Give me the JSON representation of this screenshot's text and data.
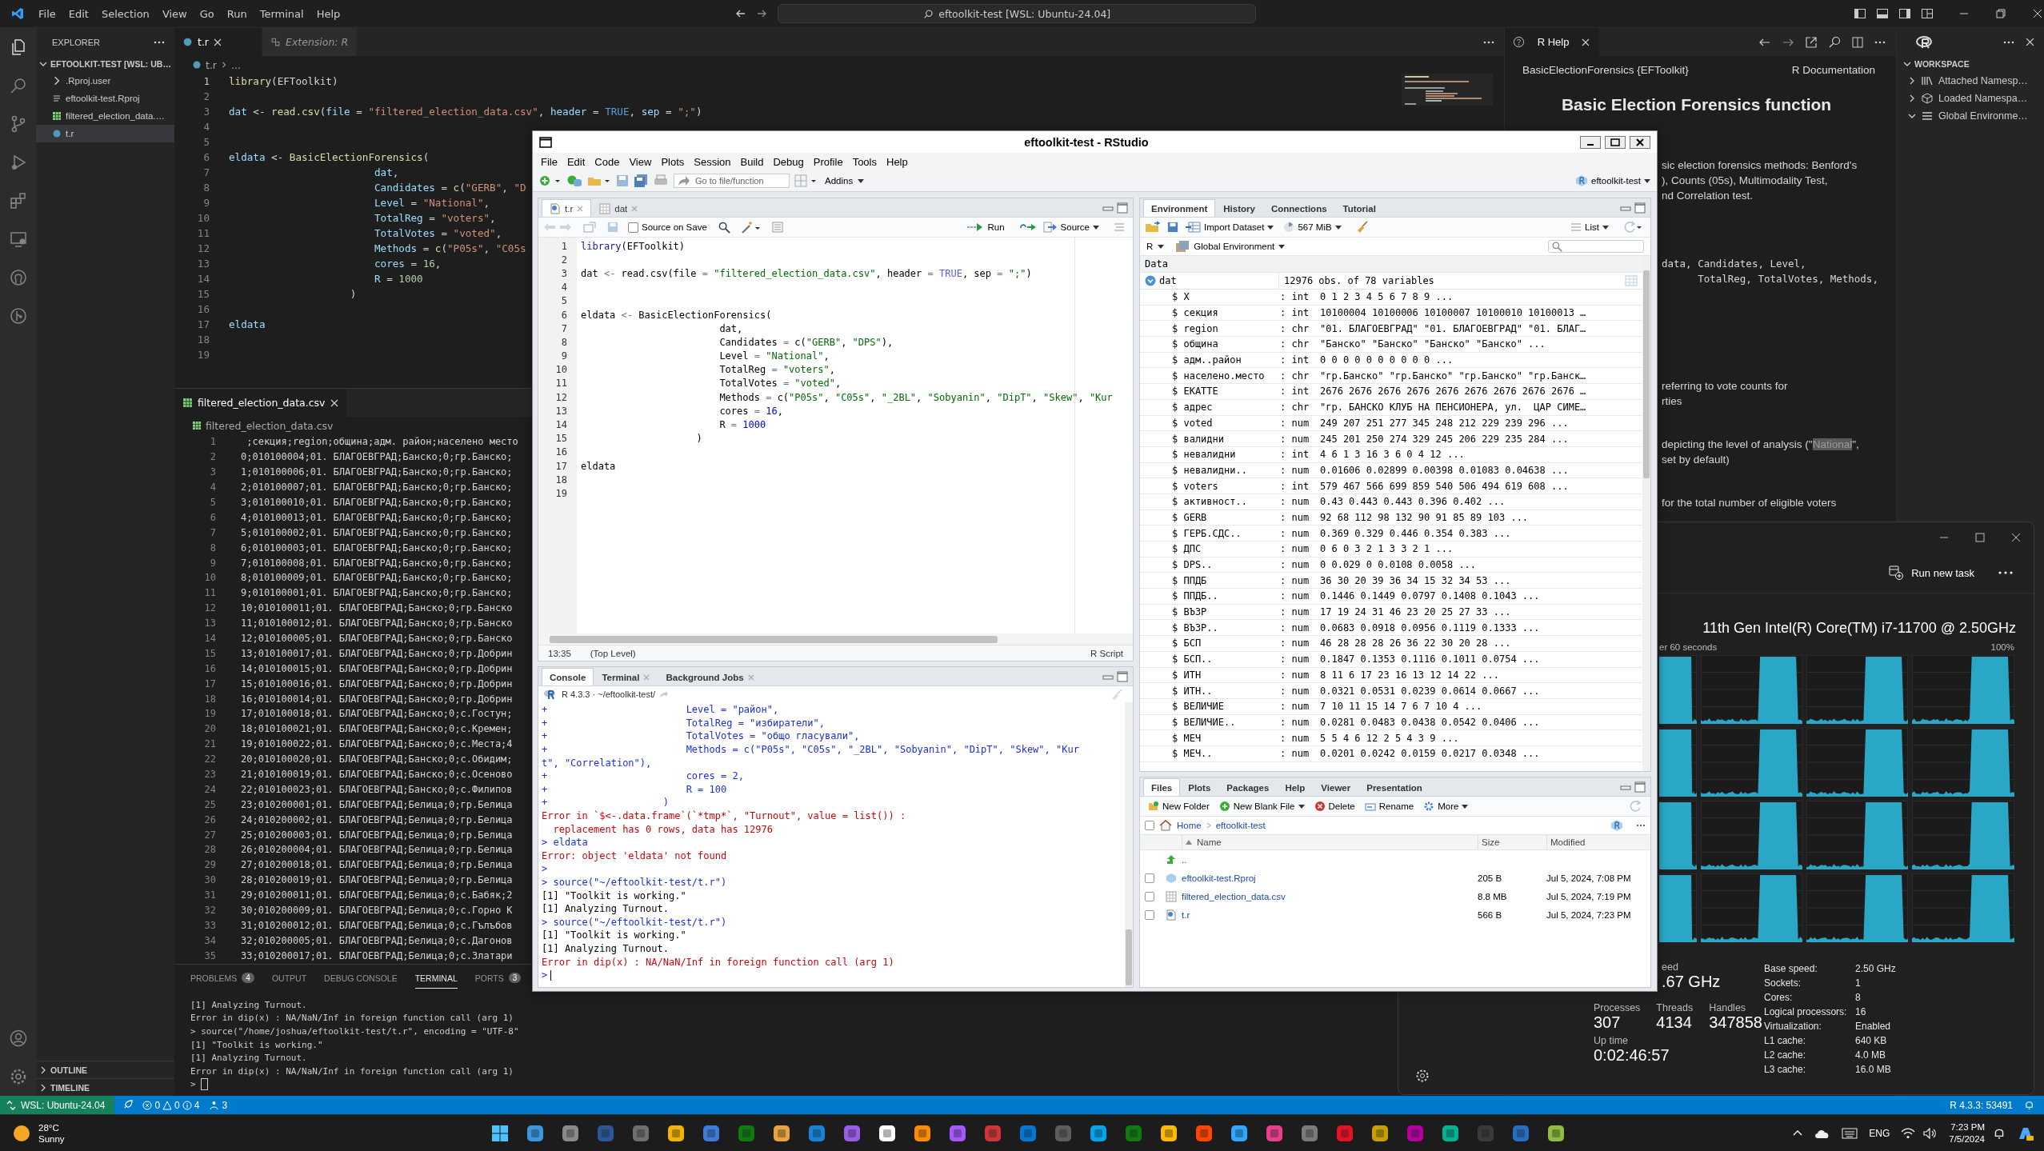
{
  "vscode": {
    "menu": [
      "File",
      "Edit",
      "Selection",
      "View",
      "Go",
      "Run",
      "Terminal",
      "Help"
    ],
    "search": "eftoolkit-test [WSL: Ubuntu-24.04]",
    "explorer": {
      "title": "EXPLORER",
      "root": "EFTOOLKIT-TEST [WSL: UB…",
      "expanded": true,
      "items": [
        {
          "label": ".Rproj.user",
          "kind": "folder",
          "selected": false
        },
        {
          "label": "eftoolkit-test.Rproj",
          "kind": "rproj",
          "selected": false
        },
        {
          "label": "filtered_election_data.…",
          "kind": "csv",
          "selected": false
        },
        {
          "label": "t.r",
          "kind": "r",
          "selected": true
        }
      ],
      "sections": [
        "OUTLINE",
        "TIMELINE"
      ]
    },
    "tabs": [
      {
        "label": "t.r",
        "kind": "r",
        "selected": true
      },
      {
        "label": "Extension: R",
        "kind": "ext",
        "selected": false
      }
    ],
    "breadcrumb": [
      "t.r",
      "..."
    ],
    "code": [
      {
        "n": "1",
        "s": [
          {
            "text": "library",
            "kind": "fn"
          },
          {
            "text": "(EFToolkit)",
            "kind": "p"
          }
        ]
      },
      {
        "n": "2"
      },
      {
        "n": "3",
        "s": [
          {
            "text": "dat",
            "kind": "var"
          },
          {
            "text": " <- ",
            "kind": "p"
          },
          {
            "text": "read.csv",
            "kind": "fn"
          },
          {
            "text": "(",
            "kind": "p"
          },
          {
            "text": "file",
            "kind": "var"
          },
          {
            "text": " = ",
            "kind": "p"
          },
          {
            "text": "\"filtered_election_data.csv\"",
            "kind": "str"
          },
          {
            "text": ", ",
            "kind": "p"
          },
          {
            "text": "header",
            "kind": "var"
          },
          {
            "text": " = ",
            "kind": "p"
          },
          {
            "text": "TRUE",
            "kind": "const"
          },
          {
            "text": ", ",
            "kind": "p"
          },
          {
            "text": "sep",
            "kind": "var"
          },
          {
            "text": " = ",
            "kind": "p"
          },
          {
            "text": "\";\"",
            "kind": "str"
          },
          {
            "text": ")",
            "kind": "p"
          }
        ]
      },
      {
        "n": "4"
      },
      {
        "n": "5"
      },
      {
        "n": "6",
        "s": [
          {
            "text": "eldata",
            "kind": "var"
          },
          {
            "text": " <- ",
            "kind": "p"
          },
          {
            "text": "BasicElectionForensics",
            "kind": "fn"
          },
          {
            "text": "(",
            "kind": "p"
          }
        ]
      },
      {
        "n": "7",
        "s": [
          {
            "text": "                        dat",
            "kind": "var"
          },
          {
            "text": ",",
            "kind": "p"
          }
        ]
      },
      {
        "n": "8",
        "s": [
          {
            "text": "                        Candidates",
            "kind": "var"
          },
          {
            "text": " = ",
            "kind": "p"
          },
          {
            "text": "c",
            "kind": "fn"
          },
          {
            "text": "(",
            "kind": "p"
          },
          {
            "text": "\"GERB\"",
            "kind": "str"
          },
          {
            "text": ", ",
            "kind": "p"
          },
          {
            "text": "\"D",
            "kind": "str"
          }
        ]
      },
      {
        "n": "9",
        "s": [
          {
            "text": "                        Level",
            "kind": "var"
          },
          {
            "text": " = ",
            "kind": "p"
          },
          {
            "text": "\"National\"",
            "kind": "str"
          },
          {
            "text": ",",
            "kind": "p"
          }
        ]
      },
      {
        "n": "10",
        "s": [
          {
            "text": "                        TotalReg",
            "kind": "var"
          },
          {
            "text": " = ",
            "kind": "p"
          },
          {
            "text": "\"voters\"",
            "kind": "str"
          },
          {
            "text": ",",
            "kind": "p"
          }
        ]
      },
      {
        "n": "11",
        "s": [
          {
            "text": "                        TotalVotes",
            "kind": "var"
          },
          {
            "text": " = ",
            "kind": "p"
          },
          {
            "text": "\"voted\"",
            "kind": "str"
          },
          {
            "text": ",",
            "kind": "p"
          }
        ]
      },
      {
        "n": "12",
        "s": [
          {
            "text": "                        Methods",
            "kind": "var"
          },
          {
            "text": " = ",
            "kind": "p"
          },
          {
            "text": "c",
            "kind": "fn"
          },
          {
            "text": "(",
            "kind": "p"
          },
          {
            "text": "\"P05s\"",
            "kind": "str"
          },
          {
            "text": ", ",
            "kind": "p"
          },
          {
            "text": "\"C05s",
            "kind": "str"
          }
        ]
      },
      {
        "n": "13",
        "s": [
          {
            "text": "                        cores",
            "kind": "var"
          },
          {
            "text": " = ",
            "kind": "p"
          },
          {
            "text": "16",
            "kind": "num"
          },
          {
            "text": ",",
            "kind": "p"
          }
        ]
      },
      {
        "n": "14",
        "s": [
          {
            "text": "                        R",
            "kind": "var"
          },
          {
            "text": " = ",
            "kind": "p"
          },
          {
            "text": "1000",
            "kind": "num"
          }
        ]
      },
      {
        "n": "15",
        "s": [
          {
            "text": "                    )",
            "kind": "p"
          }
        ]
      },
      {
        "n": "16"
      },
      {
        "n": "17",
        "s": [
          {
            "text": "eldata",
            "kind": "var"
          }
        ]
      },
      {
        "n": "18"
      },
      {
        "n": "19"
      }
    ],
    "csv_tab": "filtered_election_data.csv",
    "csv_breadcrumb": "filtered_election_data.csv",
    "csv": [
      {
        "n": "1",
        "t": " ;секция;region;община;адм. район;населено место"
      },
      {
        "n": "2",
        "t": "0;010100004;01. БЛАГОЕВГРАД;Банско;0;гр.Банско;"
      },
      {
        "n": "3",
        "t": "1;010100006;01. БЛАГОЕВГРАД;Банско;0;гр.Банско;"
      },
      {
        "n": "4",
        "t": "2;010100007;01. БЛАГОЕВГРАД;Банско;0;гр.Банско;"
      },
      {
        "n": "5",
        "t": "3;010100010;01. БЛАГОЕВГРАД;Банско;0;гр.Банско;"
      },
      {
        "n": "6",
        "t": "4;010100013;01. БЛАГОЕВГРАД;Банско;0;гр.Банско;"
      },
      {
        "n": "7",
        "t": "5;010100002;01. БЛАГОЕВГРАД;Банско;0;гр.Банско;"
      },
      {
        "n": "8",
        "t": "6;010100003;01. БЛАГОЕВГРАД;Банско;0;гр.Банско;"
      },
      {
        "n": "9",
        "t": "7;010100008;01. БЛАГОЕВГРАД;Банско;0;гр.Банско;"
      },
      {
        "n": "10",
        "t": "8;010100009;01. БЛАГОЕВГРАД;Банско;0;гр.Банско;"
      },
      {
        "n": "11",
        "t": "9;010100001;01. БЛАГОЕВГРАД;Банско;0;гр.Банско;"
      },
      {
        "n": "12",
        "t": "10;010100011;01. БЛАГОЕВГРАД;Банско;0;гр.Банско"
      },
      {
        "n": "13",
        "t": "11;010100012;01. БЛАГОЕВГРАД;Банско;0;гр.Банско"
      },
      {
        "n": "14",
        "t": "12;010100005;01. БЛАГОЕВГРАД;Банско;0;гр.Банско"
      },
      {
        "n": "15",
        "t": "13;010100017;01. БЛАГОЕВГРАД;Банско;0;гр.Добрин"
      },
      {
        "n": "16",
        "t": "14;010100015;01. БЛАГОЕВГРАД;Банско;0;гр.Добрин"
      },
      {
        "n": "17",
        "t": "15;010100016;01. БЛАГОЕВГРАД;Банско;0;гр.Добрин"
      },
      {
        "n": "18",
        "t": "16;010100014;01. БЛАГОЕВГРАД;Банско;0;гр.Добрин"
      },
      {
        "n": "19",
        "t": "17;010100018;01. БЛАГОЕВГРАД;Банско;0;с.Гостун;"
      },
      {
        "n": "20",
        "t": "18;010100021;01. БЛАГОЕВГРАД;Банско;0;с.Кремен;"
      },
      {
        "n": "21",
        "t": "19;010100022;01. БЛАГОЕВГРАД;Банско;0;с.Места;4"
      },
      {
        "n": "22",
        "t": "20;010100020;01. БЛАГОЕВГРАД;Банско;0;с.Обидим;"
      },
      {
        "n": "23",
        "t": "21;010100019;01. БЛАГОЕВГРАД;Банско;0;с.Осеново"
      },
      {
        "n": "24",
        "t": "22;010100023;01. БЛАГОЕВГРАД;Банско;0;с.Филипов"
      },
      {
        "n": "25",
        "t": "23;010200001;01. БЛАГОЕВГРАД;Белица;0;гр.Белица"
      },
      {
        "n": "26",
        "t": "24;010200002;01. БЛАГОЕВГРАД;Белица;0;гр.Белица"
      },
      {
        "n": "27",
        "t": "25;010200003;01. БЛАГОЕВГРАД;Белица;0;гр.Белица"
      },
      {
        "n": "28",
        "t": "26;010200004;01. БЛАГОЕВГРАД;Белица;0;гр.Белица"
      },
      {
        "n": "29",
        "t": "27;010200018;01. БЛАГОЕВГРАД;Белица;0;гр.Белица"
      },
      {
        "n": "30",
        "t": "28;010200019;01. БЛАГОЕВГРАД;Белица;0;гр.Белица"
      },
      {
        "n": "31",
        "t": "29;010200011;01. БЛАГОЕВГРАД;Белица;0;с.Бабяк;2"
      },
      {
        "n": "32",
        "t": "30;010200009;01. БЛАГОЕВГРАД;Белица;0;с.Горно К"
      },
      {
        "n": "33",
        "t": "31;010200012;01. БЛАГОЕВГРАД;Белица;0;с.Гълъбов"
      },
      {
        "n": "34",
        "t": "32;010200005;01. БЛАГОЕВГРАД;Белица;0;с.Дагонов"
      },
      {
        "n": "35",
        "t": "33;010200017;01. БЛАГОЕВГРАД;Белица;0;с.Златари"
      }
    ],
    "panel_tabs": [
      {
        "label": "PROBLEMS",
        "count": "4",
        "selected": false
      },
      {
        "label": "OUTPUT",
        "selected": false
      },
      {
        "label": "DEBUG CONSOLE",
        "selected": false
      },
      {
        "label": "TERMINAL",
        "selected": true
      },
      {
        "label": "PORTS",
        "count": "3",
        "selected": false
      }
    ],
    "terminal": [
      {
        "t": "[1] Analyzing Turnout."
      },
      {
        "t": "Error in dip(x) : NA/NaN/Inf in foreign function call (arg 1)"
      },
      {
        "t": "> source(\"/home/joshua/eftoolkit-test/t.r\", encoding = \"UTF-8\""
      },
      {
        "t": "[1] \"Toolkit is working.\""
      },
      {
        "t": "[1] Analyzing Turnout."
      },
      {
        "t": "Error in dip(x) : NA/NaN/Inf in foreign function call (arg 1)"
      },
      {
        "t": ">",
        "cursor": true
      }
    ],
    "status": {
      "remote": "WSL: Ubuntu-24.04",
      "errors": "0",
      "warnings": "0",
      "infos": "4",
      "ports": "3",
      "r_session": "R 4.3.3: 53491"
    }
  },
  "r_help": {
    "tab": "R Help",
    "topic": "BasicElectionForensics {EFToolkit}",
    "doc": "R Documentation",
    "heading": "Basic Election Forensics function",
    "blocks": [
      {
        "kind": "prose",
        "lines": [
          "sic election forensics methods: Benford's",
          "), Counts (05s), Multimodality Test,",
          "nd Correlation test."
        ]
      },
      {
        "kind": "code",
        "lines": [
          "data, Candidates, Level,",
          "      TotalReg, TotalVotes, Methods,"
        ]
      },
      {
        "kind": "prose",
        "lines": [
          "referring to vote counts for",
          "rties"
        ]
      },
      {
        "kind": "prose",
        "lines": [
          {
            "before": "depicting the level of analysis (\"",
            "mark": "National",
            "after": "\","
          },
          "set by default)"
        ]
      },
      {
        "kind": "prose",
        "lines": [
          "for the total number of eligible voters"
        ]
      }
    ]
  },
  "workspace": {
    "title": "WORKSPACE",
    "items": [
      {
        "label": "Attached Namesp…",
        "kind": "library",
        "expanded": false
      },
      {
        "label": "Loaded Namespa…",
        "kind": "package",
        "expanded": false
      },
      {
        "label": "Global Environme…",
        "kind": "list",
        "expanded": true
      }
    ]
  },
  "rstudio": {
    "title": "eftoolkit-test - RStudio",
    "menu": [
      "File",
      "Edit",
      "Code",
      "View",
      "Plots",
      "Session",
      "Build",
      "Debug",
      "Profile",
      "Tools",
      "Help"
    ],
    "goto": "Go to file/function",
    "addins": "Addins",
    "project": "eftoolkit-test",
    "editor": {
      "tabs": [
        {
          "label": "t.r",
          "kind": "script",
          "selected": true
        },
        {
          "label": "dat",
          "kind": "data",
          "selected": false
        }
      ],
      "source_on_save": {
        "label": "Source on Save",
        "checked": false
      },
      "run": "Run",
      "source": "Source",
      "lines": [
        {
          "n": "1",
          "s": [
            {
              "text": "library",
              "kind": "fn"
            },
            {
              "text": "(EFToolkit)",
              "kind": "p"
            }
          ]
        },
        {
          "n": "2"
        },
        {
          "n": "3",
          "s": [
            {
              "text": "dat ",
              "kind": "p"
            },
            {
              "text": "<-",
              "kind": "op"
            },
            {
              "text": " read.csv(file ",
              "kind": "p"
            },
            {
              "text": "= ",
              "kind": "op"
            },
            {
              "text": "\"filtered_election_data.csv\"",
              "kind": "str"
            },
            {
              "text": ", header ",
              "kind": "p"
            },
            {
              "text": "= ",
              "kind": "op"
            },
            {
              "text": "TRUE",
              "kind": "const"
            },
            {
              "text": ", sep ",
              "kind": "p"
            },
            {
              "text": "= ",
              "kind": "op"
            },
            {
              "text": "\";\"",
              "kind": "str"
            },
            {
              "text": ")",
              "kind": "p"
            }
          ]
        },
        {
          "n": "4"
        },
        {
          "n": "5"
        },
        {
          "n": "6",
          "s": [
            {
              "text": "eldata ",
              "kind": "p"
            },
            {
              "text": "<-",
              "kind": "op"
            },
            {
              "text": " BasicElectionForensics(",
              "kind": "p"
            }
          ]
        },
        {
          "n": "7",
          "s": [
            {
              "text": "                        dat,",
              "kind": "p"
            }
          ]
        },
        {
          "n": "8",
          "s": [
            {
              "text": "                        Candidates ",
              "kind": "p"
            },
            {
              "text": "=",
              "kind": "op"
            },
            {
              "text": " c(",
              "kind": "p"
            },
            {
              "text": "\"GERB\"",
              "kind": "str"
            },
            {
              "text": ", ",
              "kind": "p"
            },
            {
              "text": "\"DPS\"",
              "kind": "str"
            },
            {
              "text": "),",
              "kind": "p"
            }
          ]
        },
        {
          "n": "9",
          "s": [
            {
              "text": "                        Level ",
              "kind": "p"
            },
            {
              "text": "= ",
              "kind": "op"
            },
            {
              "text": "\"National\"",
              "kind": "str"
            },
            {
              "text": ",",
              "kind": "p"
            }
          ]
        },
        {
          "n": "10",
          "s": [
            {
              "text": "                        TotalReg ",
              "kind": "p"
            },
            {
              "text": "= ",
              "kind": "op"
            },
            {
              "text": "\"voters\"",
              "kind": "str"
            },
            {
              "text": ",",
              "kind": "p"
            }
          ]
        },
        {
          "n": "11",
          "s": [
            {
              "text": "                        TotalVotes ",
              "kind": "p"
            },
            {
              "text": "= ",
              "kind": "op"
            },
            {
              "text": "\"voted\"",
              "kind": "str"
            },
            {
              "text": ",",
              "kind": "p"
            }
          ]
        },
        {
          "n": "12",
          "s": [
            {
              "text": "                        Methods ",
              "kind": "p"
            },
            {
              "text": "=",
              "kind": "op"
            },
            {
              "text": " c(",
              "kind": "p"
            },
            {
              "text": "\"P05s\"",
              "kind": "str"
            },
            {
              "text": ", ",
              "kind": "p"
            },
            {
              "text": "\"C05s\"",
              "kind": "str"
            },
            {
              "text": ", ",
              "kind": "p"
            },
            {
              "text": "\"_2BL\"",
              "kind": "str"
            },
            {
              "text": ", ",
              "kind": "p"
            },
            {
              "text": "\"Sobyanin\"",
              "kind": "str"
            },
            {
              "text": ", ",
              "kind": "p"
            },
            {
              "text": "\"DipT\"",
              "kind": "str"
            },
            {
              "text": ", ",
              "kind": "p"
            },
            {
              "text": "\"Skew\"",
              "kind": "str"
            },
            {
              "text": ", ",
              "kind": "p"
            },
            {
              "text": "\"Kur",
              "kind": "str"
            }
          ]
        },
        {
          "n": "13",
          "s": [
            {
              "text": "                        cores ",
              "kind": "p"
            },
            {
              "text": "= ",
              "kind": "op"
            },
            {
              "text": "16",
              "kind": "num"
            },
            {
              "text": ",",
              "kind": "p"
            }
          ]
        },
        {
          "n": "14",
          "s": [
            {
              "text": "                        R ",
              "kind": "p"
            },
            {
              "text": "= ",
              "kind": "op"
            },
            {
              "text": "1000",
              "kind": "num"
            }
          ]
        },
        {
          "n": "15",
          "s": [
            {
              "text": "                    )",
              "kind": "p"
            }
          ]
        },
        {
          "n": "16"
        },
        {
          "n": "17",
          "s": [
            {
              "text": "eldata",
              "kind": "p"
            }
          ]
        },
        {
          "n": "18"
        },
        {
          "n": "19"
        }
      ],
      "position": "13:35",
      "scope": "(Top Level)",
      "filetype": "R Script"
    },
    "console": {
      "tabs": [
        {
          "label": "Console",
          "selected": true,
          "closable": false
        },
        {
          "label": "Terminal",
          "selected": false,
          "closable": true
        },
        {
          "label": "Background Jobs",
          "selected": false,
          "closable": true
        }
      ],
      "header": "R 4.3.3 · ~/eftoolkit-test/",
      "lines": [
        {
          "p": "+",
          "t": "                        Level = \"район\",",
          "kind": "input"
        },
        {
          "p": "+",
          "t": "                        TotalReg = \"избиратели\",",
          "kind": "input"
        },
        {
          "p": "+",
          "t": "                        TotalVotes = \"общо гласували\",",
          "kind": "input"
        },
        {
          "p": "+",
          "t": "                        Methods = c(\"P05s\", \"C05s\", \"_2BL\", \"Sobyanin\", \"DipT\", \"Skew\", \"Kur",
          "kind": "input"
        },
        {
          "t": "t\", \"Correlation\"),",
          "kind": "input"
        },
        {
          "p": "+",
          "t": "                        cores = 2,",
          "kind": "input"
        },
        {
          "p": "+",
          "t": "                        R = 100",
          "kind": "input"
        },
        {
          "p": "+",
          "t": "                    )",
          "kind": "input"
        },
        {
          "t": "Error in `$<-.data.frame`(`*tmp*`, \"Turnout\", value = list()) :",
          "kind": "error"
        },
        {
          "t": "  replacement has 0 rows, data has 12976",
          "kind": "error"
        },
        {
          "p": ">",
          "t": " eldata",
          "kind": "input"
        },
        {
          "t": "Error: object 'eldata' not found",
          "kind": "error"
        },
        {
          "p": ">",
          "kind": "input"
        },
        {
          "p": ">",
          "t": " source(\"~/eftoolkit-test/t.r\")",
          "kind": "input"
        },
        {
          "t": "[1] \"Toolkit is working.\"",
          "kind": "output"
        },
        {
          "t": "[1] Analyzing Turnout.",
          "kind": "output"
        },
        {
          "p": ">",
          "t": " source(\"~/eftoolkit-test/t.r\")",
          "kind": "input"
        },
        {
          "t": "[1] \"Toolkit is working.\"",
          "kind": "output"
        },
        {
          "t": "[1] Analyzing Turnout.",
          "kind": "output"
        },
        {
          "t": "Error in dip(x) : NA/NaN/Inf in foreign function call (arg 1)",
          "kind": "error"
        },
        {
          "p": ">",
          "kind": "input"
        }
      ]
    },
    "environment": {
      "tabs": [
        {
          "label": "Environment",
          "selected": true
        },
        {
          "label": "History",
          "selected": false
        },
        {
          "label": "Connections",
          "selected": false
        },
        {
          "label": "Tutorial",
          "selected": false
        }
      ],
      "import": "Import Dataset",
      "memory": "567 MiB",
      "view": "List",
      "language": "R",
      "scope": "Global Environment",
      "section": "Data",
      "object": {
        "name": "dat",
        "summary": "12976 obs. of 78 variables",
        "expanded": true
      },
      "vars": [
        {
          "name": "$ X",
          "type": ": int",
          "value": "0 1 2 3 4 5 6 7 8 9 ..."
        },
        {
          "name": "$ секция",
          "type": ": int",
          "value": "10100004 10100006 10100007 10100010 10100013 …"
        },
        {
          "name": "$ region",
          "type": ": chr",
          "value": "\"01. БЛАГОЕВГРАД\" \"01. БЛАГОЕВГРАД\" \"01. БЛАГ…"
        },
        {
          "name": "$ община",
          "type": ": chr",
          "value": "\"Банско\" \"Банско\" \"Банско\" \"Банско\" ..."
        },
        {
          "name": "$ адм..район",
          "type": ": int",
          "value": "0 0 0 0 0 0 0 0 0 0 ..."
        },
        {
          "name": "$ населено.место",
          "type": ": chr",
          "value": "\"гр.Банско\" \"гр.Банско\" \"гр.Банско\" \"гр.Банск…"
        },
        {
          "name": "$ ЕКАТТЕ",
          "type": ": int",
          "value": "2676 2676 2676 2676 2676 2676 2676 2676 2676 …"
        },
        {
          "name": "$ адрес",
          "type": ": chr",
          "value": "\"гр. БАНСКО КЛУБ НА ПЕНСИОНЕРА, ул.  ЦАР СИМЕ…"
        },
        {
          "name": "$ voted",
          "type": ": num",
          "value": "249 207 251 277 345 248 212 229 239 296 ..."
        },
        {
          "name": "$ валидни",
          "type": ": num",
          "value": "245 201 250 274 329 245 206 229 235 284 ..."
        },
        {
          "name": "$ невалидни",
          "type": ": int",
          "value": "4 6 1 3 16 3 6 0 4 12 ..."
        },
        {
          "name": "$ невалидни..",
          "type": ": num",
          "value": "0.01606 0.02899 0.00398 0.01083 0.04638 ..."
        },
        {
          "name": "$ voters",
          "type": ": int",
          "value": "579 467 566 699 859 540 506 494 619 608 ..."
        },
        {
          "name": "$ активност..",
          "type": ": num",
          "value": "0.43 0.443 0.443 0.396 0.402 ..."
        },
        {
          "name": "$ GERB",
          "type": ": num",
          "value": "92 68 112 98 132 90 91 85 89 103 ..."
        },
        {
          "name": "$ ГЕРБ.СДС..",
          "type": ": num",
          "value": "0.369 0.329 0.446 0.354 0.383 ..."
        },
        {
          "name": "$ ДПС",
          "type": ": num",
          "value": "0 6 0 3 2 1 3 3 2 1 ..."
        },
        {
          "name": "$ DPS..",
          "type": ": num",
          "value": "0 0.029 0 0.0108 0.0058 ..."
        },
        {
          "name": "$ ППДБ",
          "type": ": num",
          "value": "36 30 20 39 36 34 15 32 34 53 ..."
        },
        {
          "name": "$ ППДБ..",
          "type": ": num",
          "value": "0.1446 0.1449 0.0797 0.1408 0.1043 ..."
        },
        {
          "name": "$ ВЪЗР",
          "type": ": num",
          "value": "17 19 24 31 46 23 20 25 27 33 ..."
        },
        {
          "name": "$ ВЪЗР..",
          "type": ": num",
          "value": "0.0683 0.0918 0.0956 0.1119 0.1333 ..."
        },
        {
          "name": "$ БСП",
          "type": ": num",
          "value": "46 28 28 28 26 36 22 30 20 28 ..."
        },
        {
          "name": "$ БСП..",
          "type": ": num",
          "value": "0.1847 0.1353 0.1116 0.1011 0.0754 ..."
        },
        {
          "name": "$ ИТН",
          "type": ": num",
          "value": "8 11 6 17 23 16 13 12 14 22 ..."
        },
        {
          "name": "$ ИТН..",
          "type": ": num",
          "value": "0.0321 0.0531 0.0239 0.0614 0.0667 ..."
        },
        {
          "name": "$ ВЕЛИЧИЕ",
          "type": ": num",
          "value": "7 10 11 15 14 7 6 7 10 4 ..."
        },
        {
          "name": "$ ВЕЛИЧИЕ..",
          "type": ": num",
          "value": "0.0281 0.0483 0.0438 0.0542 0.0406 ..."
        },
        {
          "name": "$ МЕЧ",
          "type": ": num",
          "value": "5 5 4 6 12 2 5 4 3 9 ..."
        },
        {
          "name": "$ МЕЧ..",
          "type": ": num",
          "value": "0.0201 0.0242 0.0159 0.0217 0.0348 ..."
        }
      ]
    },
    "files": {
      "tabs": [
        {
          "label": "Files",
          "selected": true
        },
        {
          "label": "Plots",
          "selected": false
        },
        {
          "label": "Packages",
          "selected": false
        },
        {
          "label": "Help",
          "selected": false
        },
        {
          "label": "Viewer",
          "selected": false
        },
        {
          "label": "Presentation",
          "selected": false
        }
      ],
      "actions": [
        {
          "label": "New Folder",
          "kind": "folder",
          "menu": false
        },
        {
          "label": "New Blank File",
          "kind": "file",
          "menu": true
        },
        {
          "label": "Delete",
          "kind": "delete",
          "menu": false
        },
        {
          "label": "Rename",
          "kind": "rename",
          "menu": false
        },
        {
          "label": "More",
          "kind": "more",
          "menu": true
        }
      ],
      "path": [
        "Home",
        "eftoolkit-test"
      ],
      "all_checked": false,
      "columns": [
        "Name",
        "Size",
        "Modified"
      ],
      "up": "..",
      "rows": [
        {
          "name": "eftoolkit-test.Rproj",
          "kind": "rproj",
          "size": "205 B",
          "modified": "Jul 5, 2024, 7:08 PM",
          "checked": false
        },
        {
          "name": "filtered_election_data.csv",
          "kind": "csv",
          "size": "8.8 MB",
          "modified": "Jul 5, 2024, 7:19 PM",
          "checked": false
        },
        {
          "name": "t.r",
          "kind": "r",
          "size": "566 B",
          "modified": "Jul 5, 2024, 7:23 PM",
          "checked": false
        }
      ]
    }
  },
  "task_manager": {
    "run_task": "Run new task",
    "cpu_name": "11th Gen Intel(R) Core(TM) i7-11700 @ 2.50GHz",
    "caption": "er 60 seconds",
    "max": "100%",
    "speed_label": "eed",
    "speed_value": ".67 GHz",
    "counters": [
      {
        "label": "Processes",
        "value": "307"
      },
      {
        "label": "Threads",
        "value": "4134"
      },
      {
        "label": "Handles",
        "value": "347858"
      }
    ],
    "uptime": {
      "label": "Up time",
      "value": "0:02:46:57"
    },
    "specs": [
      {
        "label": "Base speed:",
        "value": "2.50 GHz"
      },
      {
        "label": "Sockets:",
        "value": "1"
      },
      {
        "label": "Cores:",
        "value": "8"
      },
      {
        "label": "Logical processors:",
        "value": "16"
      },
      {
        "label": "Virtualization:",
        "value": "Enabled"
      },
      {
        "label": "L1 cache:",
        "value": "640 KB"
      },
      {
        "label": "L2 cache:",
        "value": "4.0 MB"
      },
      {
        "label": "L3 cache:",
        "value": "16.0 MB"
      }
    ]
  },
  "taskbar": {
    "temp": "28°C",
    "weather": "Sunny",
    "lang": "ENG",
    "time": "7:23 PM",
    "date": "7/5/2024"
  }
}
